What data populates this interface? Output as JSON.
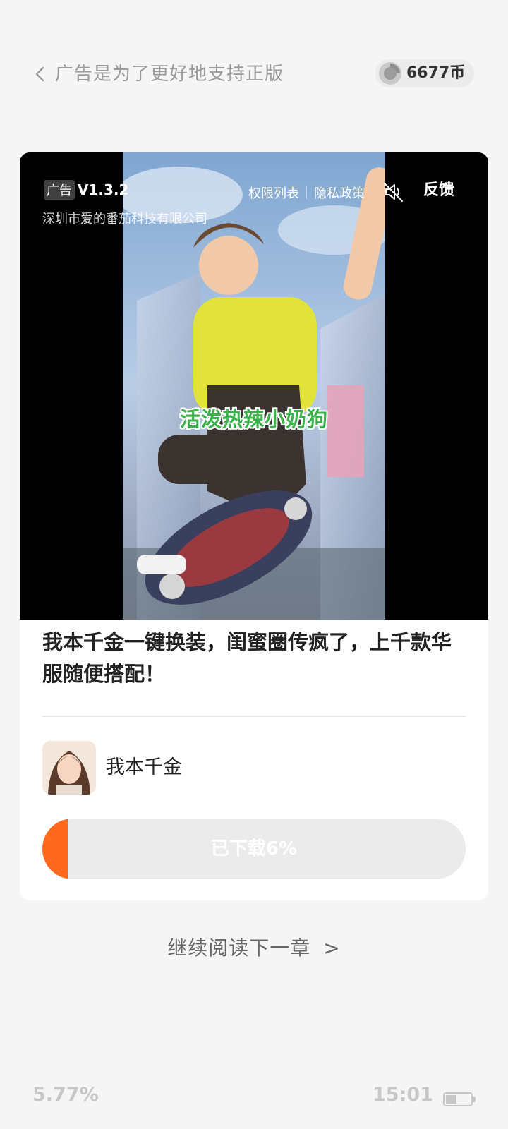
{
  "header": {
    "title": "广告是为了更好地支持正版",
    "coins": "6677币"
  },
  "ad": {
    "tag": "广告",
    "version": "V1.3.2",
    "advertiser": "深圳市爱的番茄科技有限公司",
    "permissions_link": "权限列表",
    "privacy_link": "隐私政策",
    "feedback_label": "反馈",
    "video_caption": "活泼热辣小奶狗",
    "description": "我本千金一键换装，闺蜜圈传疯了，上千款华服随便搭配！",
    "app_name": "我本千金",
    "download_label": "已下载6%",
    "download_progress": 0.06
  },
  "next_chapter": {
    "label": "继续阅读下一章",
    "arrow": ">"
  },
  "status": {
    "reading_progress": "5.77%",
    "time": "15:01",
    "battery_level": 0.45
  },
  "colors": {
    "accent": "#ff6a1f",
    "background": "#f5f5f5",
    "caption_green": "#39b24a"
  },
  "icons": {
    "back": "chevron-left-icon",
    "coin": "coin-icon",
    "mute": "speaker-muted-icon",
    "battery": "battery-icon"
  }
}
